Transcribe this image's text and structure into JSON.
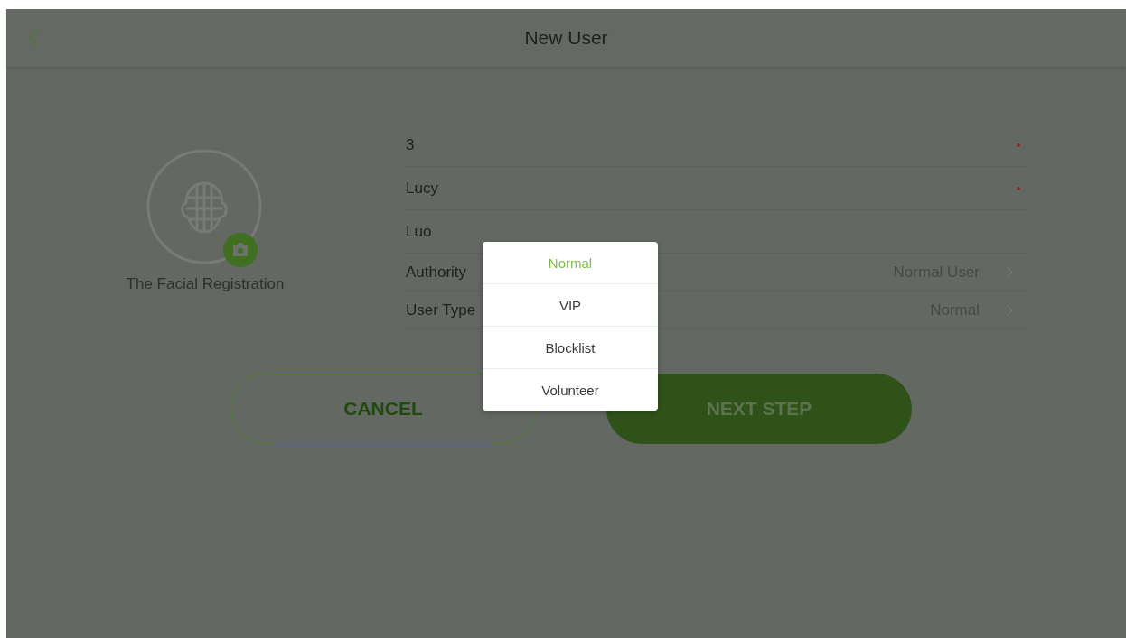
{
  "header": {
    "title": "New User"
  },
  "face": {
    "label": "The Facial Registration"
  },
  "fields": [
    {
      "kind": "text",
      "value": "3",
      "required": true
    },
    {
      "kind": "text",
      "value": "Lucy",
      "required": true
    },
    {
      "kind": "text",
      "value": "Luo",
      "required": false
    },
    {
      "kind": "select",
      "label": "Authority",
      "value": "Normal User"
    },
    {
      "kind": "select",
      "label": "User Type",
      "value": "Normal"
    }
  ],
  "buttons": [
    {
      "label": "CANCEL",
      "kind": "outline"
    },
    {
      "label": "NEXT STEP",
      "kind": "filled"
    }
  ],
  "popup": {
    "options": [
      {
        "label": "Normal",
        "selected": true
      },
      {
        "label": "VIP",
        "selected": false
      },
      {
        "label": "Blocklist",
        "selected": false
      },
      {
        "label": "Volunteer",
        "selected": false
      }
    ]
  }
}
